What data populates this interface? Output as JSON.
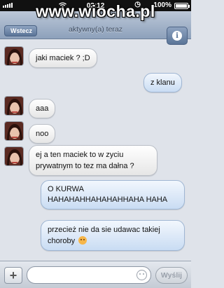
{
  "watermark": "www.wiocha.pl",
  "status_bar": {
    "time": "02:12",
    "battery": "100%",
    "battery_level": 1.0
  },
  "nav": {
    "back_label": "Wstecz",
    "subtitle": "aktywny(a) teraz",
    "info_icon": "info-icon"
  },
  "messages": [
    {
      "direction": "in",
      "text": "jaki maciek ? ;D"
    },
    {
      "direction": "out",
      "text": "z klanu"
    },
    {
      "direction": "in",
      "text": "aaa"
    },
    {
      "direction": "in",
      "text": "noo"
    },
    {
      "direction": "in",
      "text": "ej a ten maciek to w zyciu prywatnym to tez ma dałna ?"
    },
    {
      "direction": "out",
      "text": "O KURWA HAHAHAHHAHAHAHHAHA HAHA"
    },
    {
      "direction": "out",
      "text": "przecież nie da sie udawac takiej choroby",
      "emoji": "laughing-emoji"
    }
  ],
  "composer": {
    "add_label": "+",
    "input_value": "",
    "input_placeholder": "",
    "send_label": "Wyślij"
  }
}
